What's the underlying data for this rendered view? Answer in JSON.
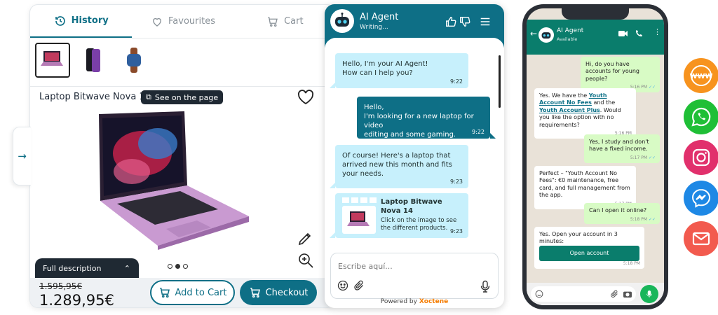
{
  "colors": {
    "teal": "#0e6f86",
    "dark": "#1f2933",
    "bubble_light": "#c7f0fc",
    "whatsapp_green": "#0a7d6c",
    "accent_orange": "#f57c00"
  },
  "shop": {
    "tabs": [
      {
        "label": "History",
        "icon": "history-icon",
        "active": true
      },
      {
        "label": "Favourites",
        "icon": "heart-icon",
        "active": false
      },
      {
        "label": "Cart",
        "icon": "cart-icon",
        "active": false
      }
    ],
    "product_title": "Laptop Bitwave Nova 14",
    "see_on_page": "See on the page",
    "full_description": "Full description",
    "old_price": "1.595,95€",
    "price": "1.289,95€",
    "add_to_cart": "Add to Cart",
    "checkout": "Checkout"
  },
  "chat": {
    "agent_name": "AI Agent",
    "status": "Writing...",
    "messages": [
      {
        "from": "bot",
        "lines": [
          "Hello, I'm your AI Agent!",
          "How can I help you?"
        ],
        "time": "9:22"
      },
      {
        "from": "user",
        "lines": [
          "Hello,",
          "I'm looking for a new laptop for video",
          "editing and some gaming."
        ],
        "time": "9:22"
      },
      {
        "from": "bot",
        "lines": [
          "Of course! Here's a laptop that",
          "arrived new this month and fits",
          "your needs."
        ],
        "time": "9:23"
      }
    ],
    "product_card": {
      "title_line1": "Laptop Bitwave",
      "title_line2": "Nova 14",
      "desc_lines": [
        "Click on the image to see",
        "the different products."
      ],
      "time": "9:23"
    },
    "input_placeholder": "Escribe aquí...",
    "powered_by": "Powered by",
    "brand": "Xoctene"
  },
  "whatsapp": {
    "name": "AI Agent",
    "status": "Available",
    "messages": [
      {
        "from": "user",
        "text": "Hi, do you have accounts for young people?",
        "time": "5:16 PM"
      },
      {
        "from": "bot",
        "text_a": "Yes. We have the ",
        "link1": "Youth Account No Fees",
        "text_b": " and the ",
        "link2": "Youth Account Plus",
        "text_c": ". Would you like the option with no requirements?",
        "time": "5:16 PM"
      },
      {
        "from": "user",
        "text": "Yes, I study and don't have a fixed income.",
        "time": "5:17 PM"
      },
      {
        "from": "bot",
        "text": "Perfect – \"Youth Account No Fees\": €0 maintenance, free card, and full management from the app.",
        "time": "5:17 PM"
      },
      {
        "from": "user",
        "text": "Can I open it online?",
        "time": "5:18 PM"
      },
      {
        "from": "bot",
        "text": "Yes. Open your account in 3 minutes:",
        "button": "Open account",
        "time": "5:18 PM"
      }
    ]
  },
  "social": [
    {
      "name": "www-icon",
      "color": "#f7931e"
    },
    {
      "name": "whatsapp-icon",
      "color": "#1fbf36"
    },
    {
      "name": "instagram-icon",
      "color": "#e1306c"
    },
    {
      "name": "messenger-icon",
      "color": "#1e88e5"
    },
    {
      "name": "email-icon",
      "color": "#f25a4e"
    }
  ]
}
